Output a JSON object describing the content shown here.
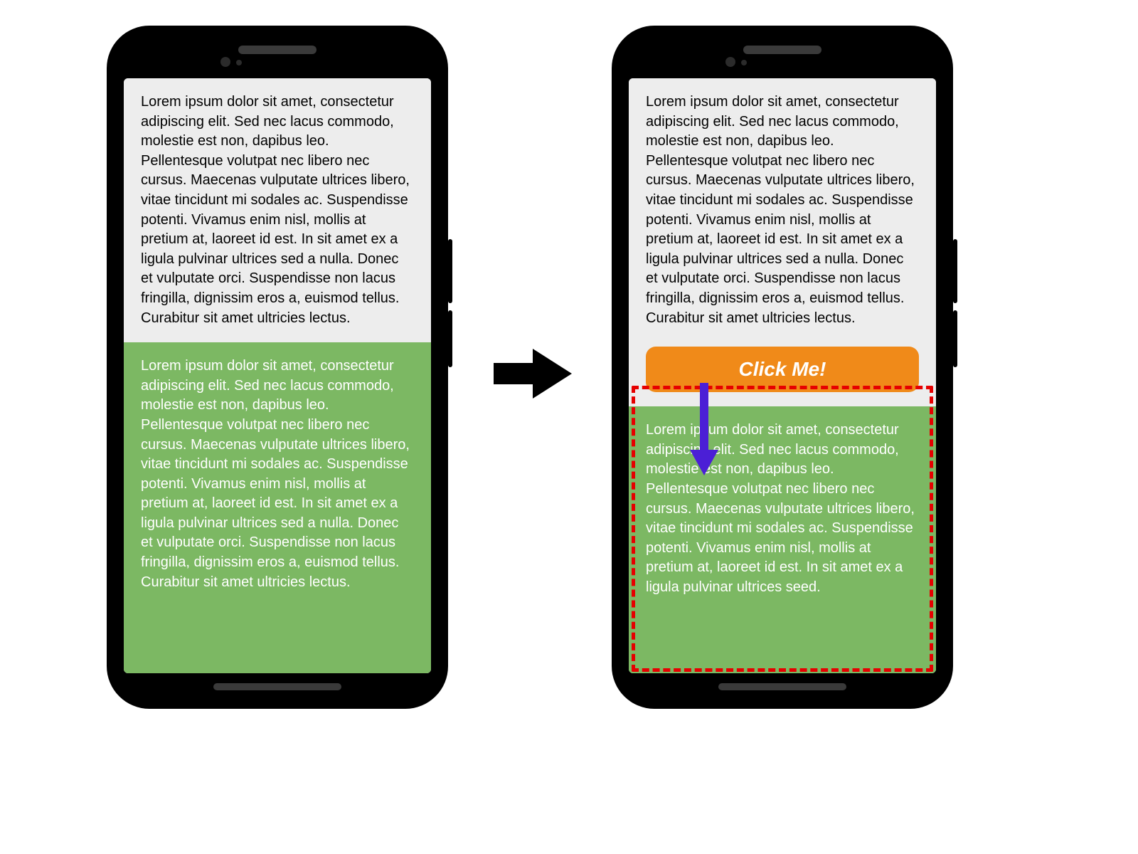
{
  "paragraph_long": "Lorem ipsum dolor sit amet, consectetur adipiscing elit. Sed nec lacus commodo, molestie est non, dapibus leo. Pellentesque volutpat nec libero nec cursus. Maecenas vulputate ultrices libero, vitae tincidunt mi sodales ac. Suspendisse potenti. Vivamus enim nisl, mollis at pretium at, laoreet id est. In sit amet ex a ligula pulvinar ultrices sed a nulla. Donec et vulputate orci. Suspendisse non lacus fringilla, dignissim eros a, euismod tellus. Curabitur sit amet ultricies lectus.",
  "paragraph_short": "Lorem ipsum dolor sit amet, consectetur adipiscing elit. Sed nec lacus commodo, molestie est non, dapibus leo. Pellentesque volutpat nec libero nec cursus. Maecenas vulputate ultrices libero, vitae tincidunt mi sodales ac. Suspendisse potenti. Vivamus enim nisl, mollis at pretium at, laoreet id est. In sit amet ex a ligula pulvinar ultrices seed.",
  "cta_label": "Click Me!",
  "colors": {
    "device_body": "#000000",
    "screen_bg": "#ededed",
    "text_dark": "#000000",
    "text_light": "#ffffff",
    "green_block": "#7cb863",
    "cta_bg": "#f08a19",
    "highlight_dash": "#e60000",
    "down_arrow": "#4b1fd6"
  }
}
